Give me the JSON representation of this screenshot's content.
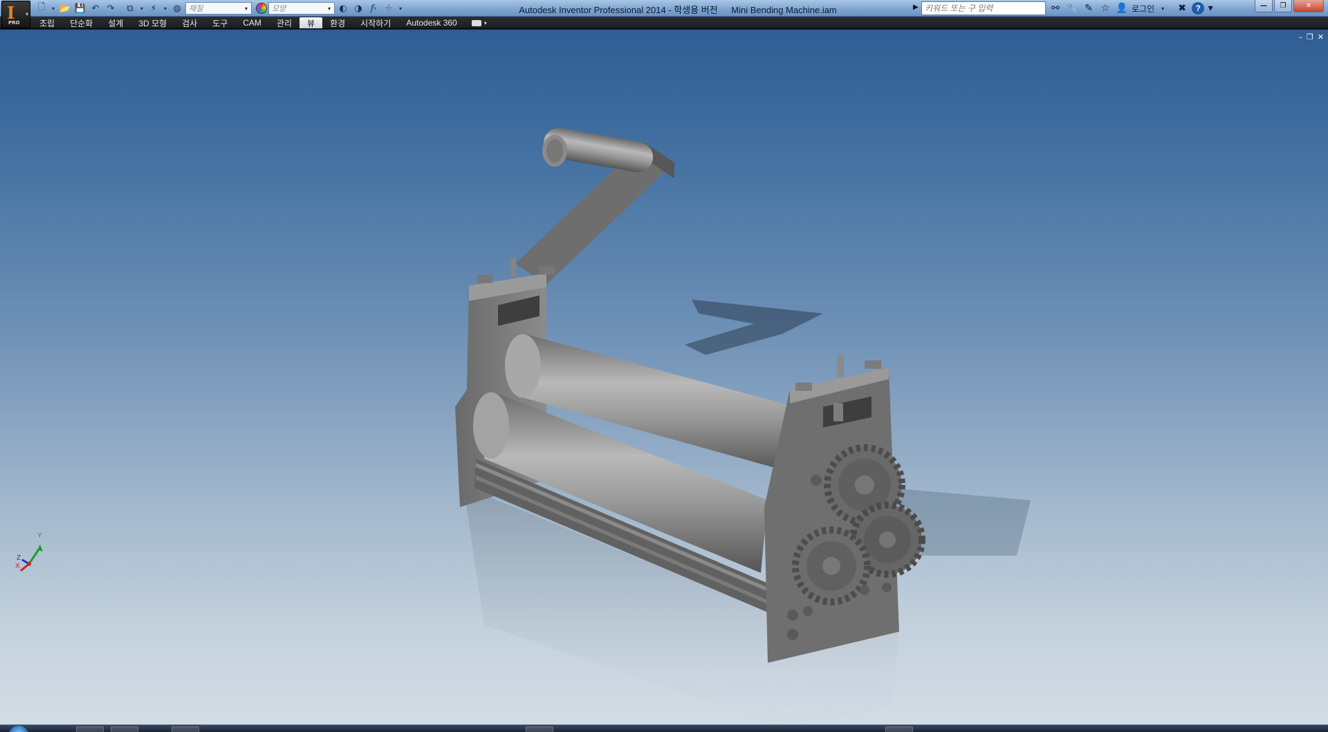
{
  "window": {
    "title": "Autodesk Inventor Professional 2014 - 학생용 버전",
    "file_name": "Mini Bending Machine.iam",
    "controls": {
      "minimize": "—",
      "restore": "❐",
      "close": "✕"
    }
  },
  "app_logo": {
    "letter": "I",
    "badge": "PRO"
  },
  "quick_access": {
    "material_placeholder": "재질",
    "appearance_placeholder": "모양",
    "formula_icon": "f",
    "formula_sub": "x"
  },
  "search": {
    "placeholder": "키워드 또는 구 입력"
  },
  "user": {
    "login_label": "로그인"
  },
  "help_label": "?",
  "ribbon_tabs": [
    {
      "label": "조립",
      "active": false
    },
    {
      "label": "단순화",
      "active": false
    },
    {
      "label": "설계",
      "active": false
    },
    {
      "label": "3D 모형",
      "active": false
    },
    {
      "label": "검사",
      "active": false
    },
    {
      "label": "도구",
      "active": false
    },
    {
      "label": "CAM",
      "active": false
    },
    {
      "label": "관리",
      "active": false
    },
    {
      "label": "뷰",
      "active": true
    },
    {
      "label": "환경",
      "active": false
    },
    {
      "label": "시작하기",
      "active": false
    },
    {
      "label": "Autodesk 360",
      "active": false
    }
  ],
  "document_controls": {
    "minimize": "–",
    "restore": "❐",
    "close": "✕"
  },
  "triad": {
    "x": "X",
    "y": "Y",
    "z": "Z"
  },
  "colors": {
    "viewport_top": "#2f5d94",
    "viewport_bottom": "#d3dce5",
    "model_gray": "#8c8c8c",
    "axis_x": "#cc2222",
    "axis_y": "#1e9c2a",
    "axis_z": "#2233cc"
  }
}
